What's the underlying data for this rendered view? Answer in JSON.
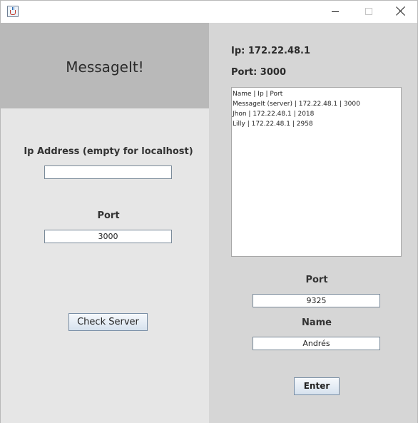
{
  "window": {
    "icon": "java-icon",
    "controls": [
      "minimize-icon",
      "maximize-icon",
      "close-icon"
    ]
  },
  "left": {
    "title": "MessageIt!",
    "ip_label": "Ip Address (empty for localhost)",
    "ip_value": "",
    "port_label": "Port",
    "port_value": "3000",
    "check_button": "Check Server"
  },
  "right": {
    "ip_text": "Ip: 172.22.48.1",
    "port_text": "Port: 3000",
    "client_list": [
      "Name | Ip | Port",
      "MessageIt (server) | 172.22.48.1 | 3000",
      "Jhon | 172.22.48.1 | 2018",
      "Lilly | 172.22.48.1 | 2958"
    ],
    "port_label": "Port",
    "port_value": "9325",
    "name_label": "Name",
    "name_value": "Andrés",
    "enter_button": "Enter"
  },
  "colors": {
    "left_panel": "#e6e6e6",
    "header_box": "#b9b9b9",
    "right_panel": "#d6d6d6"
  }
}
